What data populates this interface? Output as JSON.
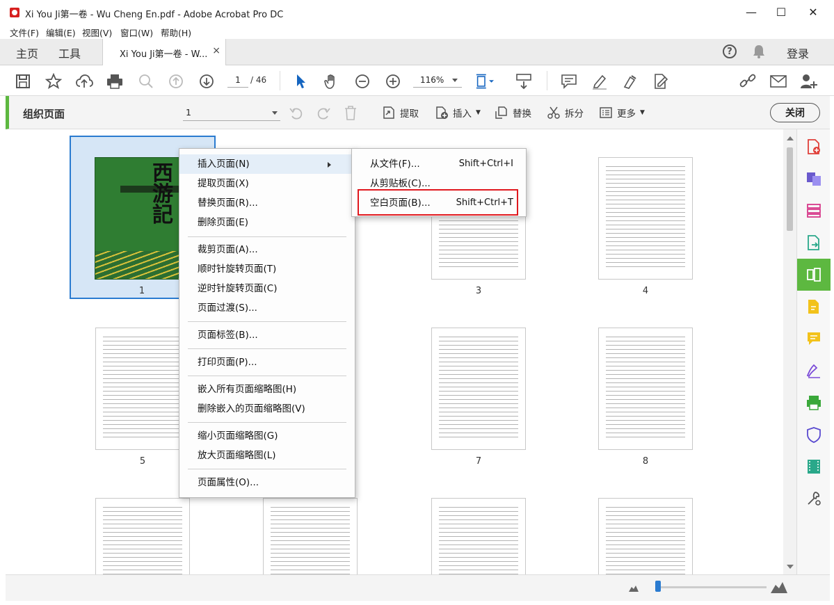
{
  "window": {
    "title": "Xi You Ji第一卷 - Wu Cheng En.pdf - Adobe Acrobat Pro DC",
    "controls": {
      "minimize": "—",
      "maximize": "☐",
      "close": "✕"
    }
  },
  "menubar": [
    "文件(F)",
    "编辑(E)",
    "视图(V)",
    "窗口(W)",
    "帮助(H)"
  ],
  "tabs": {
    "home": "主页",
    "tools": "工具",
    "document": "Xi You Ji第一卷 - W...",
    "close": "×"
  },
  "header_right": {
    "login": "登录",
    "help": "?"
  },
  "toolbar": {
    "current_page": "1",
    "total_pages": "/ 46",
    "zoom": "116%"
  },
  "organize": {
    "title": "组织页面",
    "page_select": "1",
    "extract": "提取",
    "insert": "插入",
    "replace": "替换",
    "split": "拆分",
    "more": "更多",
    "close": "关闭"
  },
  "thumbnails": [
    {
      "num": "1"
    },
    {
      "num": "3"
    },
    {
      "num": "4"
    },
    {
      "num": "5"
    },
    {
      "num": "7"
    },
    {
      "num": "8"
    }
  ],
  "cover_title": "西游记",
  "context_menu": [
    "插入页面(N)",
    "提取页面(X)",
    "替换页面(R)...",
    "删除页面(E)",
    "裁剪页面(A)...",
    "顺时针旋转页面(T)",
    "逆时针旋转页面(C)",
    "页面过渡(S)...",
    "页面标签(B)...",
    "打印页面(P)...",
    "嵌入所有页面缩略图(H)",
    "删除嵌入的页面缩略图(V)",
    "缩小页面缩略图(G)",
    "放大页面缩略图(L)",
    "页面属性(O)..."
  ],
  "submenu": [
    {
      "label": "从文件(F)...",
      "shortcut": "Shift+Ctrl+I"
    },
    {
      "label": "从剪贴板(C)...",
      "shortcut": ""
    },
    {
      "label": "空白页面(B)...",
      "shortcut": "Shift+Ctrl+T"
    }
  ],
  "colors": {
    "accent_green": "#5db840",
    "selection_blue": "#2a7bd0",
    "highlight_red": "#e0181e"
  }
}
